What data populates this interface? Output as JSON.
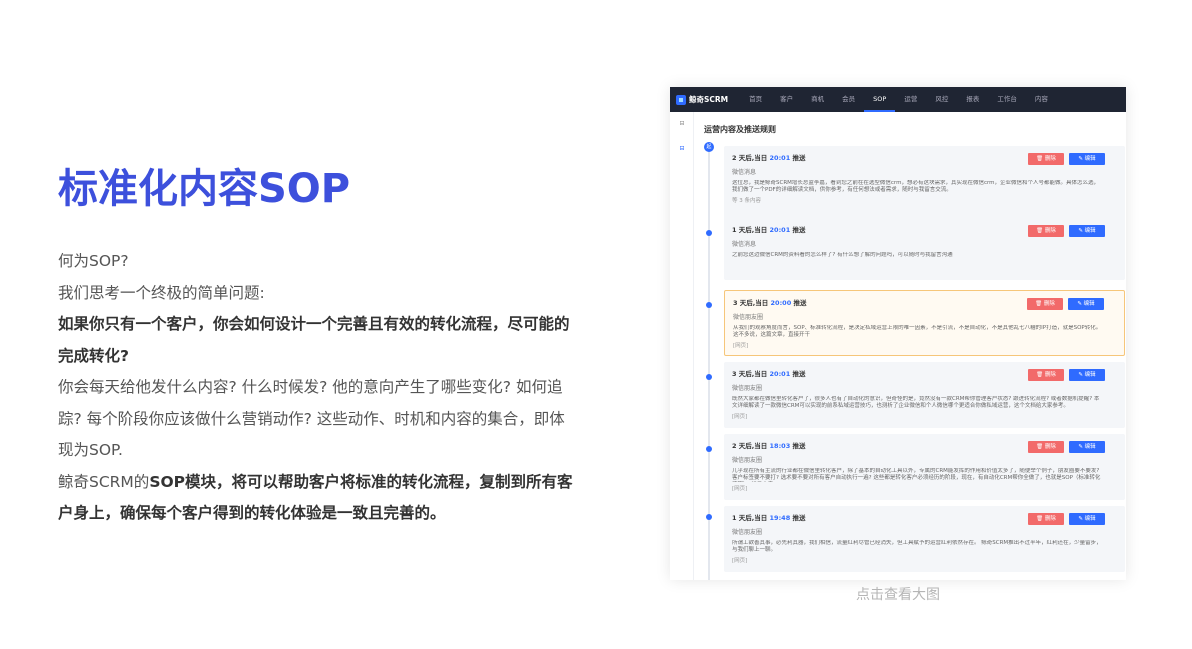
{
  "hero": {
    "title": "标准化内容SOP",
    "lines": [
      {
        "text": "何为SOP?",
        "bold": false
      },
      {
        "text": "我们思考一个终极的简单问题:",
        "bold": false
      },
      {
        "text": "如果你只有一个客户，你会如何设计一个完善且有效的转化流程，尽可能的",
        "bold": true
      },
      {
        "text": "完成转化?",
        "bold": true
      },
      {
        "text": "你会每天给他发什么内容? 什么时候发? 他的意向产生了哪些变化? 如何追",
        "bold": false
      },
      {
        "text": "踪? 每个阶段你应该做什么营销动作? 这些动作、时机和内容的集合，即体",
        "bold": false
      },
      {
        "text": "现为SOP.",
        "bold": false
      }
    ],
    "line8_plain": "鲸奇SCRM的",
    "line8_bold": "SOP模块，将可以帮助客户将标准的转化流程，复制到所有客",
    "line9_bold": "户身上，确保每个客户得到的转化体验是一致且完善的。"
  },
  "screenshot": {
    "logo": "鲸奇SCRM",
    "nav": [
      "首页",
      "客户",
      "商机",
      "会员",
      "SOP",
      "运营",
      "风控",
      "报表",
      "工作台",
      "内容"
    ],
    "active_nav": "SOP",
    "side_icons": [
      "⊟",
      "⊟"
    ],
    "section_title": "运营内容及推送规则",
    "start_label": "起",
    "delete_label": "🗑 删除",
    "edit_label": "✎ 编辑",
    "cards": [
      {
        "days": "2 天后,当日",
        "time": "20:01",
        "action": "推送",
        "channel": "微信消息",
        "text": "这位总，我是鲸奇SCRM增长总监李嘉，看到您之前在在选型微信crm，想必有这块需求，其实现在微信crm，企业微信和个人号都能做。具体怎么选，我们做了一个PDF的详细解读文档，供你参考，有任何想法或者需求，随时与我留言交流。",
        "foot": "等 3 条内容",
        "highlight": false
      },
      {
        "days": "1 天后,当日",
        "time": "20:01",
        "action": "推送",
        "channel": "微信消息",
        "text": "之前您这边微信CRM的资料看的怎么样了? 有什么想了解的问题吗，可以随时与我留言沟通",
        "foot": "",
        "highlight": false
      },
      {
        "days": "3 天后,当日",
        "time": "20:00",
        "action": "推送",
        "channel": "微信朋友圈",
        "text": "从我们的观察角度而言，SOP、标准转化流程，是决定私域运营上限的唯一因素，不是引流，不是自动化，不是其他乱七八糟的IP打造，就是SOP转化。 这不多说，这篇文章，直接开干",
        "foot": "[网页]",
        "highlight": true
      },
      {
        "days": "3 天后,当日",
        "time": "20:01",
        "action": "推送",
        "channel": "微信朋友圈",
        "text": "既然大家都在做信里转化客户了，很多人也有了自动化的意识，但奇怪的是，竟然没有一款CRM帮你管理客户状态? 跟进转化流程? 或者数据机提醒? 本文详细解读了一款微信CRM可以实现的前系私域运营技巧，也测析了企业微信和个人微信哪个更适合你做私域运营，这个文档给大家参考。",
        "foot": "[网页]",
        "highlight": false
      },
      {
        "days": "2 天后,当日",
        "time": "18:03",
        "action": "推送",
        "channel": "微信朋友圈",
        "text": "几乎现在所有主流的行业都在微信里转化客户，除了基本的自动化工具以外，专属的CRM能发挥的作用和价值太多了，随便举个例子，朋友圈要不要发? 客户标签要不要打? 选术要不要对所有客户自动执行一遍? 这些都是转化客户必须经历的阶段，现在，有自动化CRM帮你全做了，也就是SOP（标准转化流程），详见文章。",
        "foot": "[网页]",
        "highlight": false
      },
      {
        "days": "1 天后,当日",
        "time": "19:48",
        "action": "推送",
        "channel": "微信朋友圈",
        "text": "所谓工欲善其事，必先利其器，我们相信，流量红利尽管已经消失，但工具赋予的运营红利依然存在。 鲸奇SCRM推出不过半年，红利还在，少量留步，与我们聊上一聊。",
        "foot": "[网页]",
        "highlight": false
      }
    ]
  },
  "caption": "点击查看大图"
}
